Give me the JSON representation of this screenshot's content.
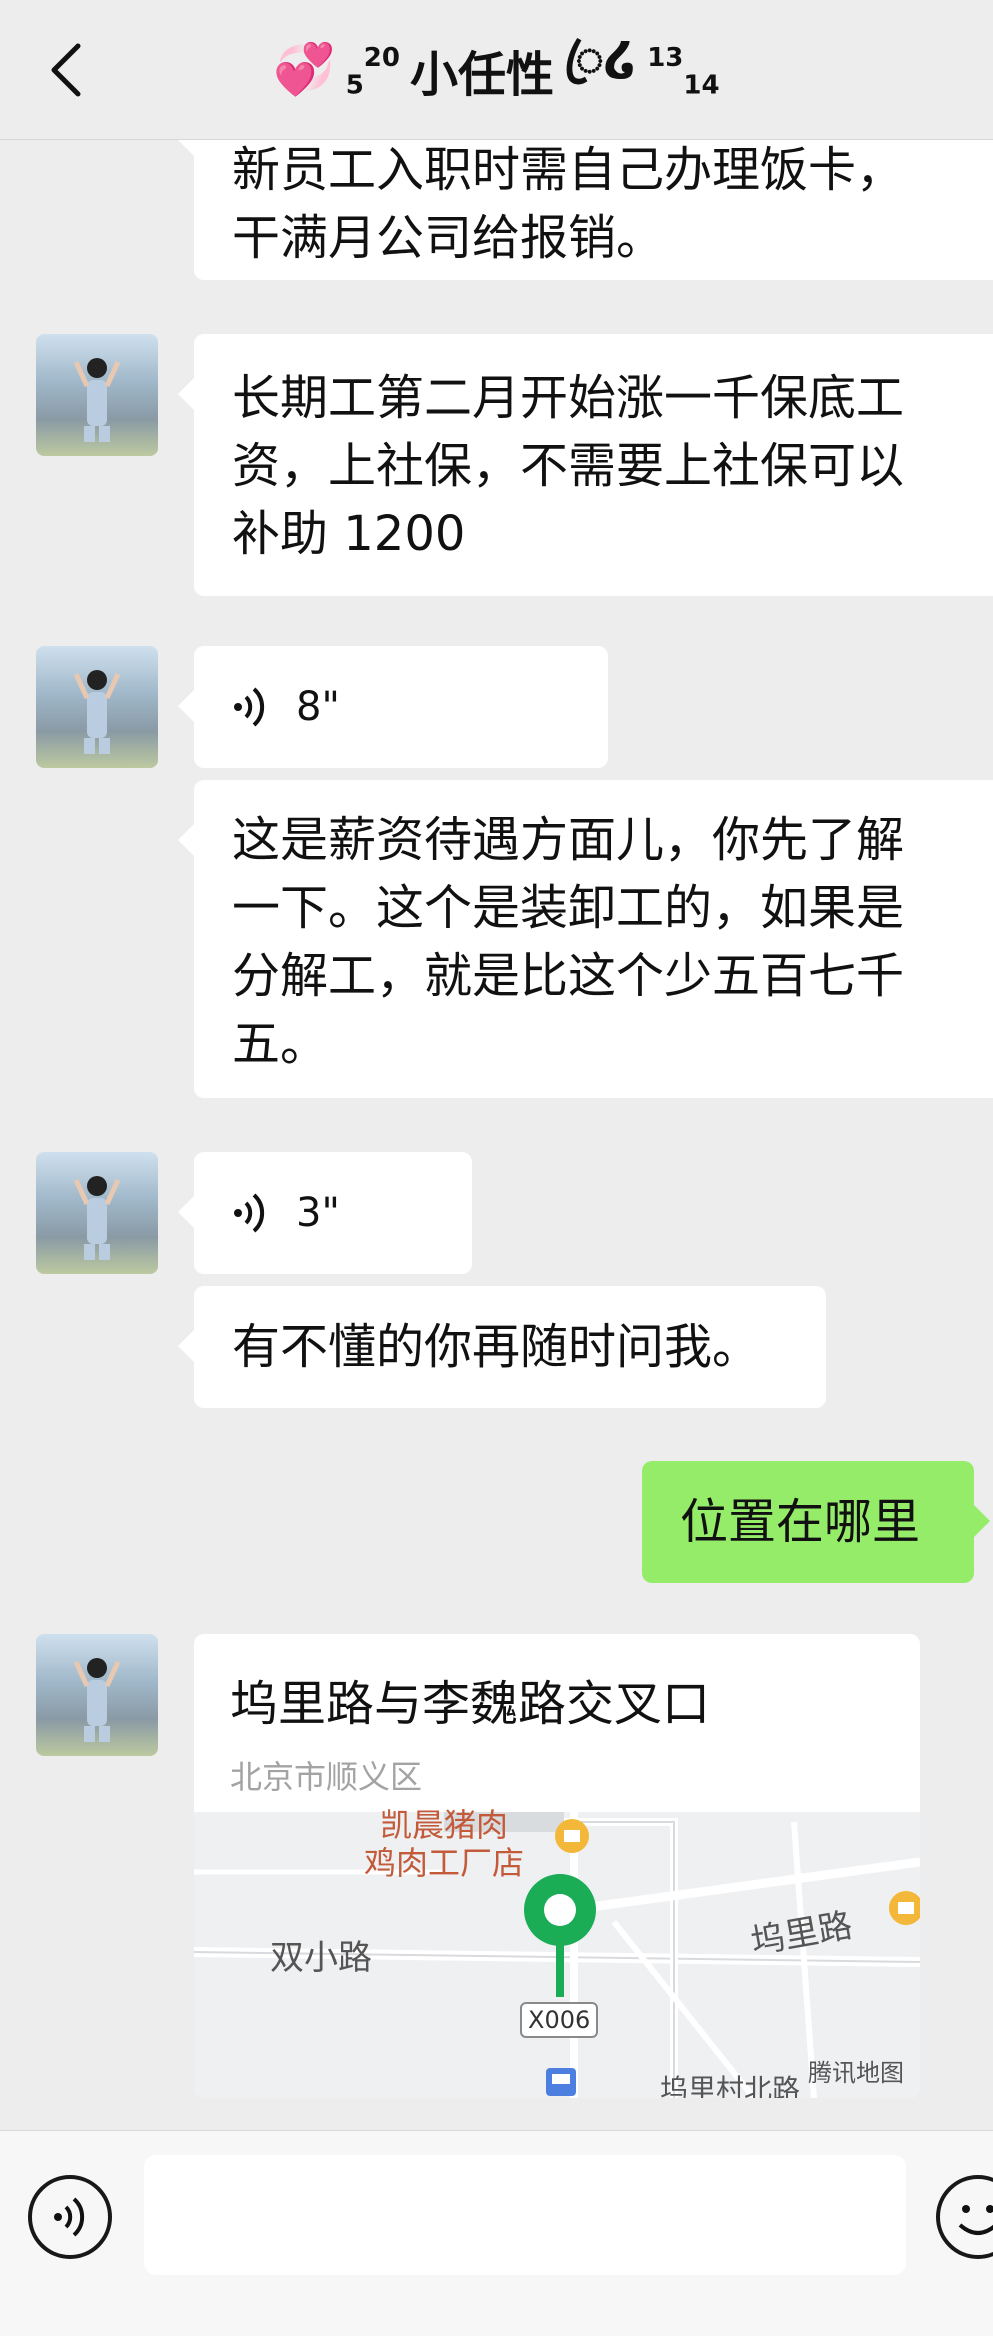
{
  "header": {
    "title_prefix_sup": "20",
    "title_prefix_sub": "5",
    "title": "小任性",
    "title_suffix_glyph": "ꦿ໒",
    "title_suffix_sup": "13",
    "title_suffix_sub": "14",
    "heart": "💞"
  },
  "messages": {
    "m1": "新员工入职时需自己办理饭卡，干满月公司给报销。",
    "m1_line1": "新员工入职时需自己办理饭卡，",
    "m1_line2": "干满月公司给报销。",
    "m2_line1": "长期工第二月开始涨一千保底工",
    "m2_line2": "资，上社保，不需要上社保可以",
    "m2_line3": "补助 1200",
    "v1": "8\"",
    "m3_line1": "这是薪资待遇方面儿，你先了解",
    "m3_line2": "一下。这个是装卸工的，如果是",
    "m3_line3": "分解工，就是比这个少五百七千",
    "m3_line4": "五。",
    "v2": "3\"",
    "m4": "有不懂的你再随时问我。",
    "m5": "位置在哪里"
  },
  "location": {
    "title": "坞里路与李魏路交叉口",
    "address": "北京市顺义区",
    "map": {
      "poi_line1": "凯晨猪肉",
      "poi_line2": "鸡肉工厂店",
      "road_a": "双小路",
      "road_b": "坞里路",
      "road_tag": "X006",
      "road_c": "坞里村北路",
      "brand": "腾讯地图"
    }
  },
  "colors": {
    "background": "#ededed",
    "sent_bubble": "#95ec69",
    "received_bubble": "#ffffff",
    "pin": "#1aad55"
  }
}
